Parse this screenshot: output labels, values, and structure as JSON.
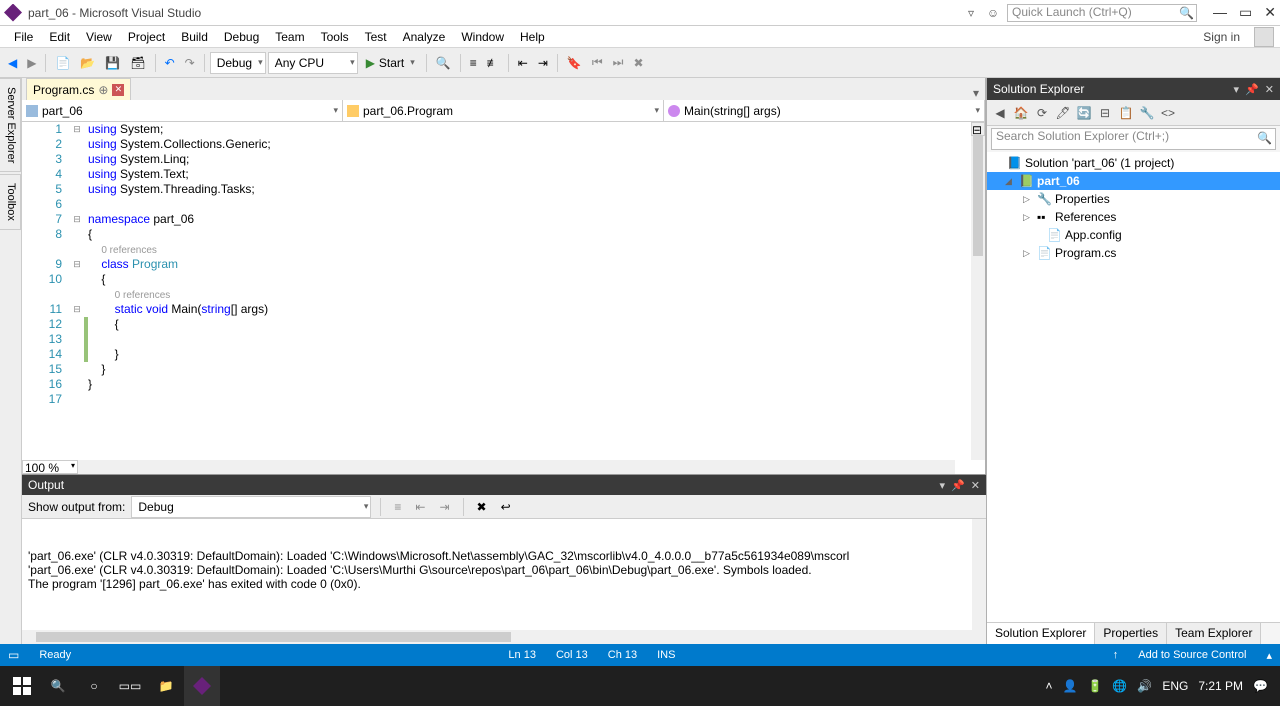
{
  "title": "part_06 - Microsoft Visual Studio",
  "quick_launch_placeholder": "Quick Launch (Ctrl+Q)",
  "menu": [
    "File",
    "Edit",
    "View",
    "Project",
    "Build",
    "Debug",
    "Team",
    "Tools",
    "Test",
    "Analyze",
    "Window",
    "Help"
  ],
  "signin": "Sign in",
  "toolbar": {
    "config": "Debug",
    "platform": "Any CPU",
    "start": "Start"
  },
  "left_dock": [
    "Server Explorer",
    "Toolbox"
  ],
  "doc_tab": "Program.cs",
  "nav": {
    "project": "part_06",
    "class": "part_06.Program",
    "member": "Main(string[] args)"
  },
  "zoom": "100 %",
  "code_lines": [
    {
      "n": 1,
      "html": "<span class='kw'>using</span> System;"
    },
    {
      "n": 2,
      "html": "<span class='kw'>using</span> System.Collections.Generic;"
    },
    {
      "n": 3,
      "html": "<span class='kw'>using</span> System.Linq;"
    },
    {
      "n": 4,
      "html": "<span class='kw'>using</span> System.Text;"
    },
    {
      "n": 5,
      "html": "<span class='kw'>using</span> System.Threading.Tasks;"
    },
    {
      "n": 6,
      "html": ""
    },
    {
      "n": 7,
      "html": "<span class='kw'>namespace</span> part_06"
    },
    {
      "n": 8,
      "html": "{"
    },
    {
      "n": "",
      "html": "    <span class='ref'>0 references</span>"
    },
    {
      "n": 9,
      "html": "    <span class='kw'>class</span> <span class='cls'>Program</span>"
    },
    {
      "n": 10,
      "html": "    {"
    },
    {
      "n": "",
      "html": "        <span class='ref'>0 references</span>"
    },
    {
      "n": 11,
      "html": "        <span class='kw'>static</span> <span class='kw'>void</span> Main(<span class='kw'>string</span>[] args)"
    },
    {
      "n": 12,
      "html": "        {"
    },
    {
      "n": 13,
      "html": ""
    },
    {
      "n": 14,
      "html": "        }"
    },
    {
      "n": 15,
      "html": "    }"
    },
    {
      "n": 16,
      "html": "}"
    },
    {
      "n": 17,
      "html": ""
    }
  ],
  "output": {
    "title": "Output",
    "from_label": "Show output from:",
    "from_value": "Debug",
    "lines": [
      "'part_06.exe' (CLR v4.0.30319: DefaultDomain): Loaded 'C:\\Windows\\Microsoft.Net\\assembly\\GAC_32\\mscorlib\\v4.0_4.0.0.0__b77a5c561934e089\\mscorl",
      "'part_06.exe' (CLR v4.0.30319: DefaultDomain): Loaded 'C:\\Users\\Murthi G\\source\\repos\\part_06\\part_06\\bin\\Debug\\part_06.exe'. Symbols loaded.",
      "The program '[1296] part_06.exe' has exited with code 0 (0x0)."
    ]
  },
  "solution_explorer": {
    "title": "Solution Explorer",
    "search_placeholder": "Search Solution Explorer (Ctrl+;)",
    "tree": {
      "solution": "Solution 'part_06' (1 project)",
      "project": "part_06",
      "items": [
        "Properties",
        "References",
        "App.config",
        "Program.cs"
      ]
    },
    "bottom_tabs": [
      "Solution Explorer",
      "Properties",
      "Team Explorer"
    ]
  },
  "status": {
    "ready": "Ready",
    "ln": "Ln 13",
    "col": "Col 13",
    "ch": "Ch 13",
    "ins": "INS",
    "scc": "Add to Source Control"
  },
  "tray": {
    "lang": "ENG",
    "time": "7:21 PM"
  }
}
